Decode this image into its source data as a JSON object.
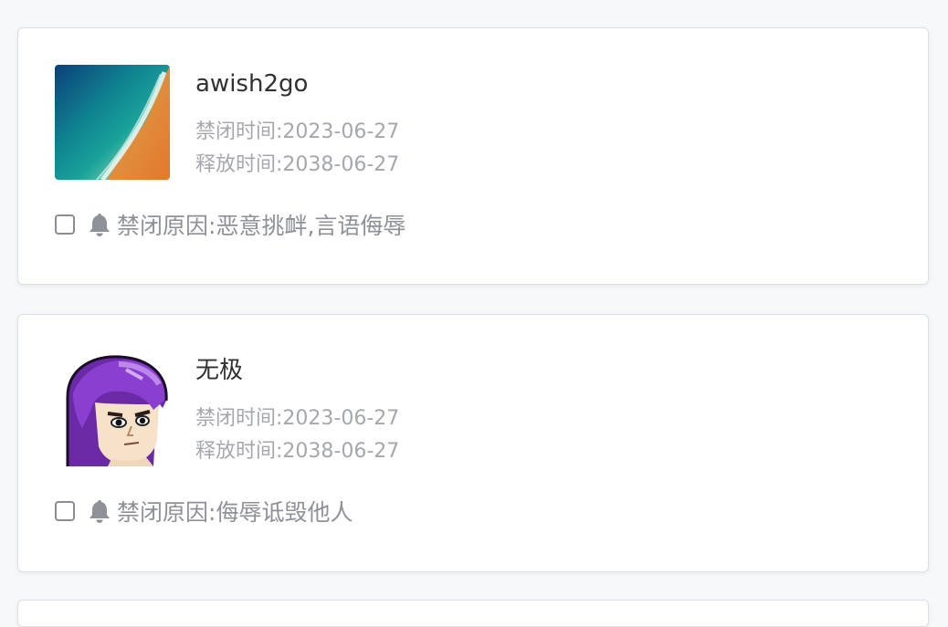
{
  "bans": [
    {
      "username": "awish2go",
      "ban_time_label": "禁闭时间:",
      "ban_time": "2023-06-27",
      "release_time_label": "释放时间:",
      "release_time": "2038-06-27",
      "reason_label": "禁闭原因:",
      "reason": "恶意挑衅,言语侮辱",
      "avatar_icon": "ocean-beach-avatar"
    },
    {
      "username": "无极",
      "ban_time_label": "禁闭时间:",
      "ban_time": "2023-06-27",
      "release_time_label": "释放时间:",
      "release_time": "2038-06-27",
      "reason_label": "禁闭原因:",
      "reason": "侮辱诋毁他人",
      "avatar_icon": "purple-hair-character-avatar"
    }
  ],
  "colors": {
    "card_border": "#dcdfe6",
    "username": "#303133",
    "meta_text": "#a4a7ad",
    "reason_text": "#8e9197",
    "bell": "#8e9197"
  },
  "icons": {
    "reason_icon": "bell-icon",
    "select_box": "checkbox"
  }
}
